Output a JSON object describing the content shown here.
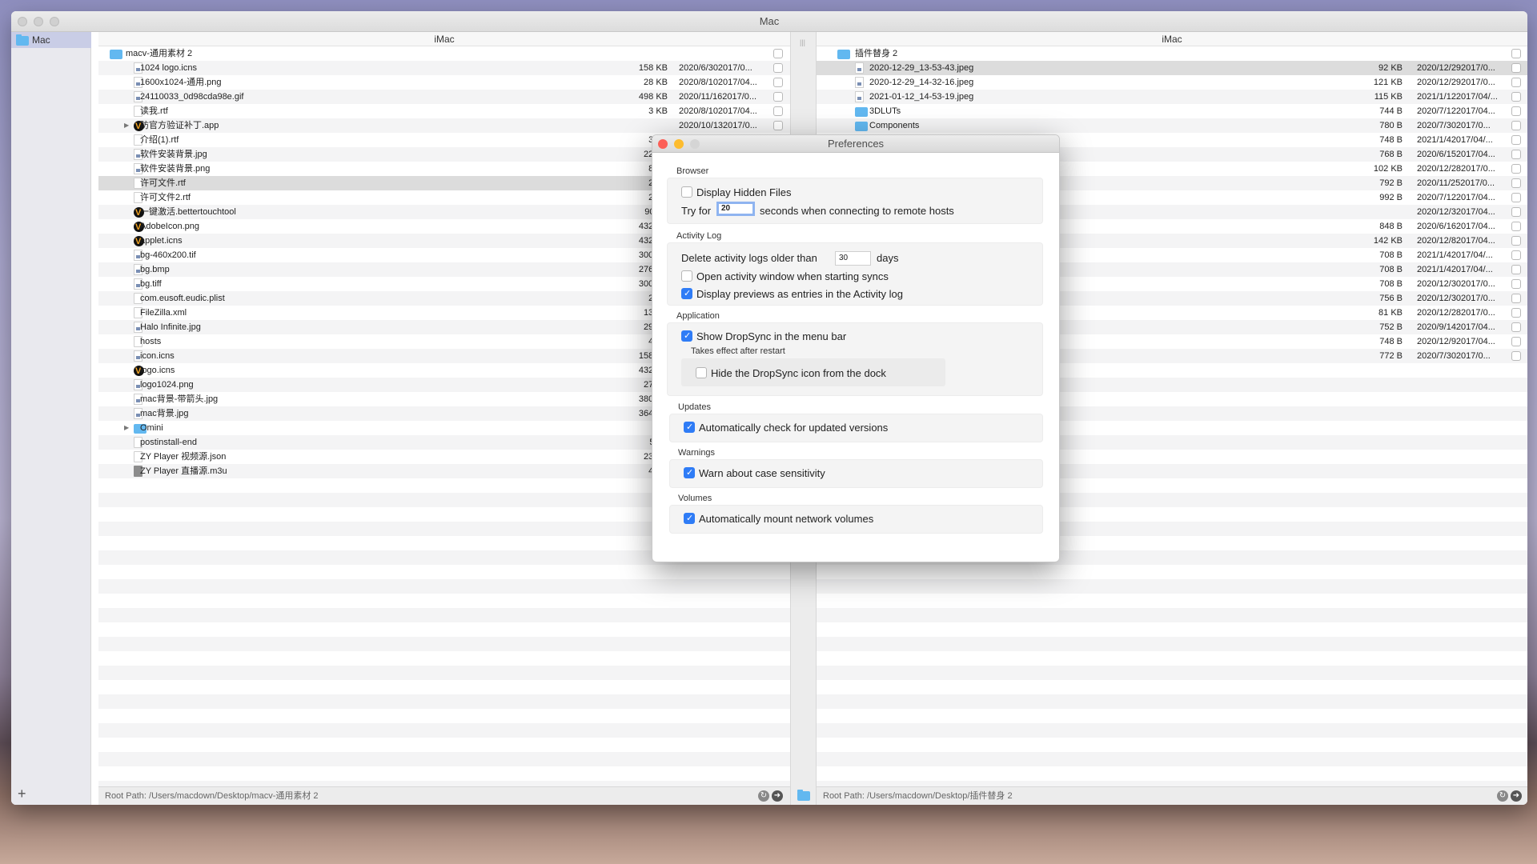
{
  "window": {
    "title": "Mac"
  },
  "sidebar": {
    "items": [
      {
        "label": "Mac",
        "icon": "folder-icon"
      }
    ],
    "add_label": "+"
  },
  "left_pane": {
    "header": "iMac",
    "root": {
      "name": "macv-通用素材 2"
    },
    "rows": [
      {
        "name": "1024 logo.icns",
        "size": "158 KB",
        "date": "2020/6/302017/0...",
        "icon": "img"
      },
      {
        "name": "1600x1024-通用.png",
        "size": "28 KB",
        "date": "2020/8/102017/04...",
        "icon": "img"
      },
      {
        "name": "24110033_0d98cda98e.gif",
        "size": "498 KB",
        "date": "2020/11/162017/0...",
        "icon": "img"
      },
      {
        "name": "读我.rtf",
        "size": "3 KB",
        "date": "2020/8/102017/04...",
        "icon": "file"
      },
      {
        "name": "防官方验证补丁.app",
        "size": "",
        "date": "2020/10/132017/0...",
        "icon": "app",
        "expandable": true
      },
      {
        "name": "介绍(1).rtf",
        "size": "3 KB",
        "icon": "file"
      },
      {
        "name": "软件安装背景.jpg",
        "size": "22 KB",
        "icon": "img"
      },
      {
        "name": "软件安装背景.png",
        "size": "8 KB",
        "icon": "img"
      },
      {
        "name": "许可文件.rtf",
        "size": "2 KB",
        "icon": "file",
        "selected": true
      },
      {
        "name": "许可文件2.rtf",
        "size": "2 KB",
        "icon": "file"
      },
      {
        "name": "一键激活.bettertouchtool",
        "size": "906 B",
        "icon": "app"
      },
      {
        "name": "AdobeIcon.png",
        "size": "432 KB",
        "icon": "app"
      },
      {
        "name": "applet.icns",
        "size": "432 KB",
        "icon": "app"
      },
      {
        "name": "bg-460x200.tif",
        "size": "300 KB",
        "icon": "img"
      },
      {
        "name": "bg.bmp",
        "size": "276 KB",
        "icon": "img"
      },
      {
        "name": "bg.tiff",
        "size": "300 KB",
        "icon": "img"
      },
      {
        "name": "com.eusoft.eudic.plist",
        "size": "2 KB",
        "icon": "file"
      },
      {
        "name": "FileZilla.xml",
        "size": "13 KB",
        "icon": "file"
      },
      {
        "name": "Halo Infinite.jpg",
        "size": "29 KB",
        "icon": "img"
      },
      {
        "name": "hosts",
        "size": "4 KB",
        "icon": "file"
      },
      {
        "name": "icon.icns",
        "size": "158 KB",
        "icon": "img"
      },
      {
        "name": "logo.icns",
        "size": "432 KB",
        "icon": "app"
      },
      {
        "name": "logo1024.png",
        "size": "27 KB",
        "icon": "img"
      },
      {
        "name": "mac背景-带箭头.jpg",
        "size": "380 KB",
        "icon": "img"
      },
      {
        "name": "mac背景.jpg",
        "size": "364 KB",
        "icon": "img"
      },
      {
        "name": "Omini",
        "size": "",
        "icon": "fold",
        "expandable": true
      },
      {
        "name": "postinstall-end",
        "size": "56 B",
        "icon": "file"
      },
      {
        "name": "ZY Player 视频源.json",
        "size": "23 KB",
        "icon": "file"
      },
      {
        "name": "ZY Player 直播源.m3u",
        "size": "4 KB",
        "icon": "m3u"
      }
    ],
    "footer": "Root Path: /Users/macdown/Desktop/macv-通用素材 2"
  },
  "right_pane": {
    "header": "iMac",
    "root": {
      "name": "插件替身 2"
    },
    "rows": [
      {
        "name": "2020-12-29_13-53-43.jpeg",
        "size": "92 KB",
        "date": "2020/12/292017/0...",
        "icon": "img",
        "selected": true
      },
      {
        "name": "2020-12-29_14-32-16.jpeg",
        "size": "121 KB",
        "date": "2020/12/292017/0...",
        "icon": "img"
      },
      {
        "name": "2021-01-12_14-53-19.jpeg",
        "size": "115 KB",
        "date": "2021/1/122017/04/...",
        "icon": "img"
      },
      {
        "name": "3DLUTs",
        "size": "744 B",
        "date": "2020/7/122017/04...",
        "icon": "fold"
      },
      {
        "name": "Components",
        "size": "780 B",
        "date": "2020/7/302017/0...",
        "icon": "fold"
      },
      {
        "name": "",
        "size": "748 B",
        "date": "2021/1/42017/04/..."
      },
      {
        "name": "",
        "size": "768 B",
        "date": "2020/6/152017/04..."
      },
      {
        "name": "",
        "size": "102 KB",
        "date": "2020/12/282017/0..."
      },
      {
        "name": "",
        "size": "792 B",
        "date": "2020/11/252017/0..."
      },
      {
        "name": "",
        "size": "992 B",
        "date": "2020/7/122017/04..."
      },
      {
        "name": "",
        "size": "",
        "date": "2020/12/32017/04..."
      },
      {
        "name": "",
        "size": "848 B",
        "date": "2020/6/162017/04..."
      },
      {
        "name": "",
        "size": "142 KB",
        "date": "2020/12/82017/04..."
      },
      {
        "name": "",
        "size": "708 B",
        "date": "2021/1/42017/04/..."
      },
      {
        "name": "",
        "size": "708 B",
        "date": "2021/1/42017/04/..."
      },
      {
        "name": "",
        "size": "708 B",
        "date": "2020/12/302017/0..."
      },
      {
        "name": "",
        "size": "756 B",
        "date": "2020/12/302017/0..."
      },
      {
        "name": "",
        "size": "81 KB",
        "date": "2020/12/282017/0..."
      },
      {
        "name": "",
        "size": "752 B",
        "date": "2020/9/142017/04..."
      },
      {
        "name": "",
        "size": "748 B",
        "date": "2020/12/92017/04..."
      },
      {
        "name": "",
        "size": "772 B",
        "date": "2020/7/302017/0..."
      }
    ],
    "footer": "Root Path: /Users/macdown/Desktop/插件替身 2"
  },
  "preferences": {
    "title": "Preferences",
    "browser": {
      "label": "Browser",
      "display_hidden": {
        "label": "Display Hidden Files",
        "checked": false
      },
      "try_for": "Try for",
      "timeout": "20",
      "timeout_suffix": "seconds when connecting to remote hosts"
    },
    "activity": {
      "label": "Activity Log",
      "delete_prefix": "Delete activity logs older than",
      "days_value": "30",
      "days_suffix": "days",
      "open_window": {
        "label": "Open activity window when starting syncs",
        "checked": false
      },
      "display_previews": {
        "label": "Display previews as entries in the Activity log",
        "checked": true
      }
    },
    "application": {
      "label": "Application",
      "show_menu": {
        "label": "Show DropSync in the menu bar",
        "checked": true
      },
      "restart_note": "Takes effect after restart",
      "hide_dock": {
        "label": "Hide the DropSync icon from the dock",
        "checked": false
      }
    },
    "updates": {
      "label": "Updates",
      "auto_check": {
        "label": "Automatically check for updated versions",
        "checked": true
      }
    },
    "warnings": {
      "label": "Warnings",
      "case": {
        "label": "Warn about case sensitivity",
        "checked": true
      }
    },
    "volumes": {
      "label": "Volumes",
      "mount": {
        "label": "Automatically mount network volumes",
        "checked": true
      }
    }
  }
}
